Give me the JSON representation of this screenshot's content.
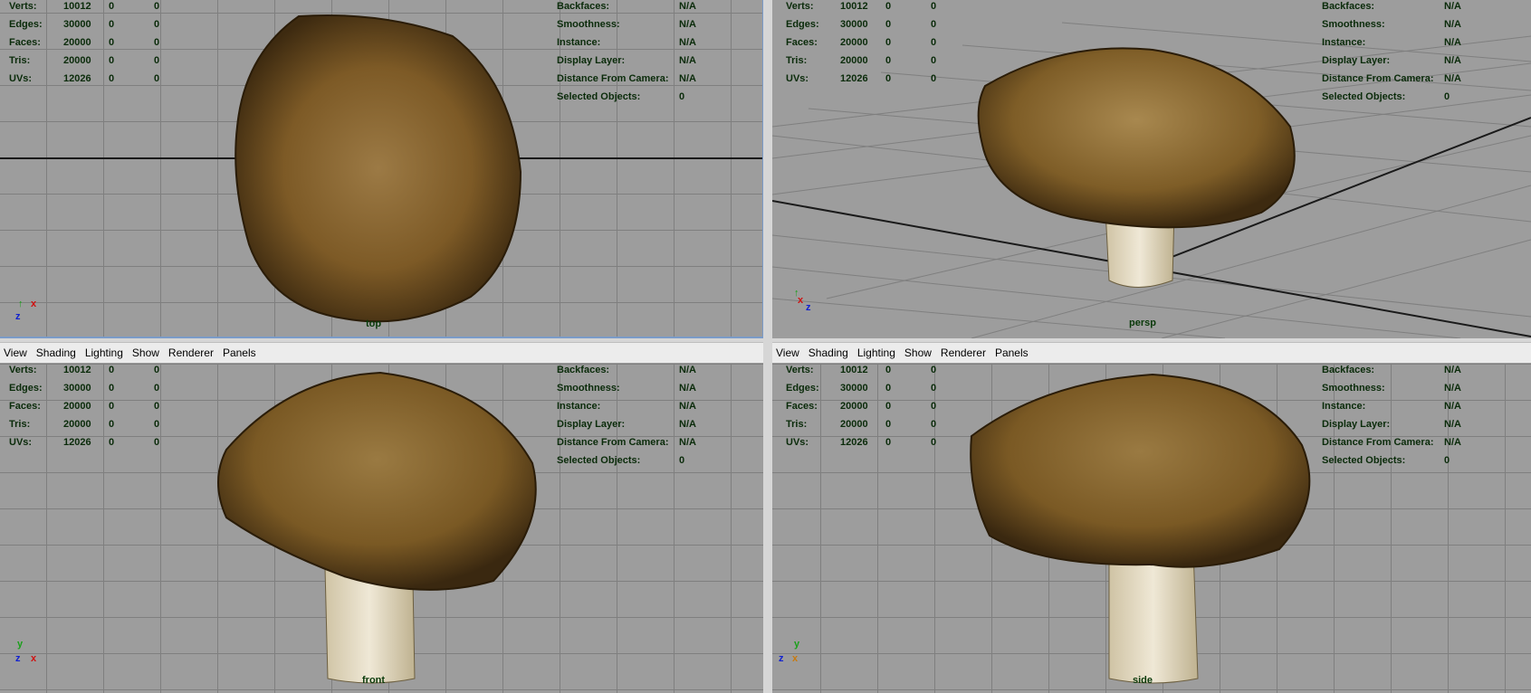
{
  "menus": {
    "left": [
      "View",
      "Shading",
      "Lighting",
      "Show",
      "Renderer",
      "Panels"
    ],
    "right": [
      "View",
      "Shading",
      "Lighting",
      "Show",
      "Renderer",
      "Panels"
    ]
  },
  "hud_left": [
    {
      "label": "Verts:",
      "value": "10012",
      "a": "0",
      "b": "0"
    },
    {
      "label": "Edges:",
      "value": "30000",
      "a": "0",
      "b": "0"
    },
    {
      "label": "Faces:",
      "value": "20000",
      "a": "0",
      "b": "0"
    },
    {
      "label": "Tris:",
      "value": "20000",
      "a": "0",
      "b": "0"
    },
    {
      "label": "UVs:",
      "value": "12026",
      "a": "0",
      "b": "0"
    }
  ],
  "hud_right": [
    {
      "label": "Backfaces:",
      "value": "N/A"
    },
    {
      "label": "Smoothness:",
      "value": "N/A"
    },
    {
      "label": "Instance:",
      "value": "N/A"
    },
    {
      "label": "Display Layer:",
      "value": "N/A"
    },
    {
      "label": "Distance From Camera:",
      "value": "N/A"
    },
    {
      "label": "Selected Objects:",
      "value": "0"
    }
  ],
  "viewports": {
    "top": {
      "camera": "top"
    },
    "persp": {
      "camera": "persp"
    },
    "front": {
      "camera": "front"
    },
    "side": {
      "camera": "side"
    }
  },
  "axes": {
    "x": "x",
    "y": "y",
    "z": "z"
  },
  "colors": {
    "viewport_bg": "#9d9d9d",
    "grid": "#7f7f7f",
    "hud_text": "#0a2b0a",
    "cap": "#7a5a22",
    "stem": "#e6ddc5",
    "axis_x": "#d01010",
    "axis_y": "#10b010",
    "axis_z": "#1020d0"
  }
}
